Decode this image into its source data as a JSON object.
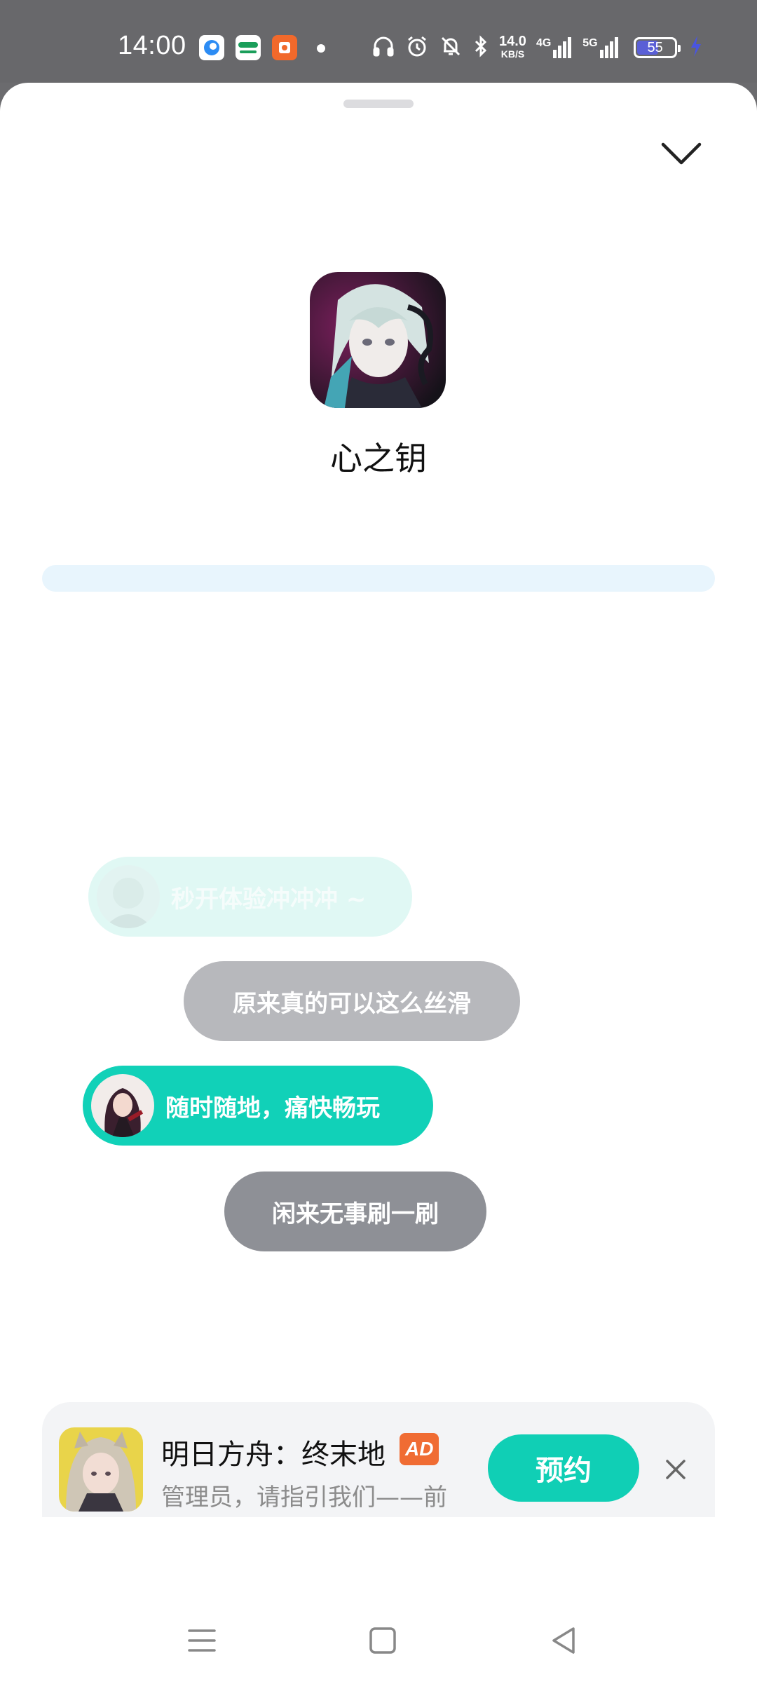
{
  "status_bar": {
    "time": "14:00",
    "speed_top": "14.0",
    "speed_bottom": "KB/S",
    "network_1": "4G",
    "network_2": "5G",
    "battery": "55",
    "icons": [
      "browser-app-icon",
      "oppo-app-icon",
      "orange-app-icon",
      "headphones-icon",
      "alarm-icon",
      "mute-icon",
      "bluetooth-icon",
      "signal-icon",
      "battery-icon",
      "charging-icon"
    ]
  },
  "app": {
    "name": "心之钥"
  },
  "progress": {
    "fraction": 0
  },
  "bubbles": [
    {
      "text": "秒开体验冲冲冲 ~"
    },
    {
      "text": "原来真的可以这么丝滑"
    },
    {
      "text": "随时随地，痛快畅玩"
    },
    {
      "text": "闲来无事刷一刷"
    }
  ],
  "ad": {
    "title": "明日方舟：终末地",
    "badge": "AD",
    "subtitle": "管理员，请指引我们——前",
    "button": "预约"
  },
  "colors": {
    "accent": "#11d1b8",
    "ad_badge": "#f06c33",
    "progress_track": "#e8f5fd"
  }
}
